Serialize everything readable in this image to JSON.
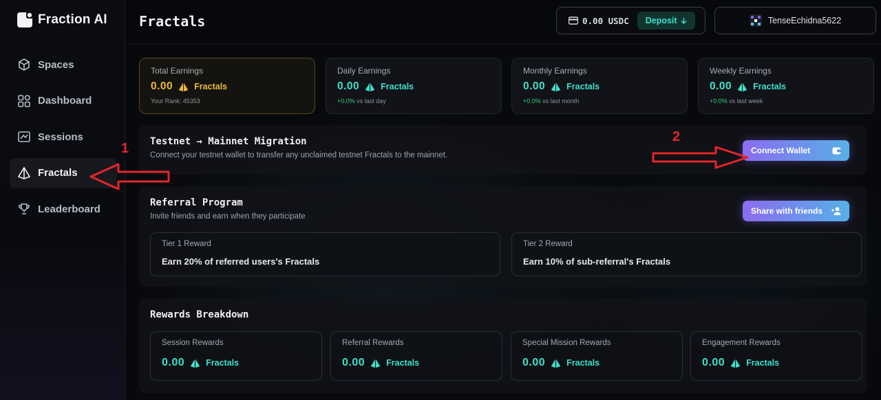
{
  "app": {
    "name": "Fraction AI"
  },
  "sidebar": {
    "items": [
      {
        "label": "Spaces",
        "icon": "cube-icon",
        "active": false
      },
      {
        "label": "Dashboard",
        "icon": "grid-icon",
        "active": false
      },
      {
        "label": "Sessions",
        "icon": "sessions-icon",
        "active": false
      },
      {
        "label": "Fractals",
        "icon": "fractal-icon",
        "active": true
      },
      {
        "label": "Leaderboard",
        "icon": "trophy-icon",
        "active": false
      }
    ]
  },
  "header": {
    "title": "Fractals",
    "balance": "0.00 USDC",
    "deposit_label": "Deposit",
    "username": "TenseEchidna5622"
  },
  "stats": [
    {
      "label": "Total Earnings",
      "value": "0.00",
      "unit": "Fractals",
      "sub": "Your Rank: 45353",
      "pct": ""
    },
    {
      "label": "Daily Earnings",
      "value": "0.00",
      "unit": "Fractals",
      "sub": "vs last day",
      "pct": "+0.0%"
    },
    {
      "label": "Monthly Earnings",
      "value": "0.00",
      "unit": "Fractals",
      "sub": "vs last month",
      "pct": "+0.0%"
    },
    {
      "label": "Weekly Earnings",
      "value": "0.00",
      "unit": "Fractals",
      "sub": "vs last week",
      "pct": "+0.0%"
    }
  ],
  "migration": {
    "title": "Testnet → Mainnet Migration",
    "description": "Connect your testnet wallet to transfer any unclaimed testnet Fractals to the mainnet.",
    "button_label": "Connect Wallet"
  },
  "referral": {
    "title": "Referral Program",
    "description": "Invite friends and earn when they participate",
    "button_label": "Share with friends",
    "tiers": [
      {
        "label": "Tier 1 Reward",
        "text": "Earn 20% of referred users's Fractals"
      },
      {
        "label": "Tier 2 Reward",
        "text": "Earn 10% of sub-referral's Fractals"
      }
    ]
  },
  "rewards": {
    "title": "Rewards Breakdown",
    "items": [
      {
        "label": "Session Rewards",
        "value": "0.00",
        "unit": "Fractals"
      },
      {
        "label": "Referral Rewards",
        "value": "0.00",
        "unit": "Fractals"
      },
      {
        "label": "Special Mission Rewards",
        "value": "0.00",
        "unit": "Fractals"
      },
      {
        "label": "Engagement Rewards",
        "value": "0.00",
        "unit": "Fractals"
      }
    ]
  },
  "annotations": {
    "one": "1",
    "two": "2"
  },
  "colors": {
    "accent": "#3fe0cb",
    "gold": "#f0b93a",
    "annotation": "#e5252a"
  }
}
